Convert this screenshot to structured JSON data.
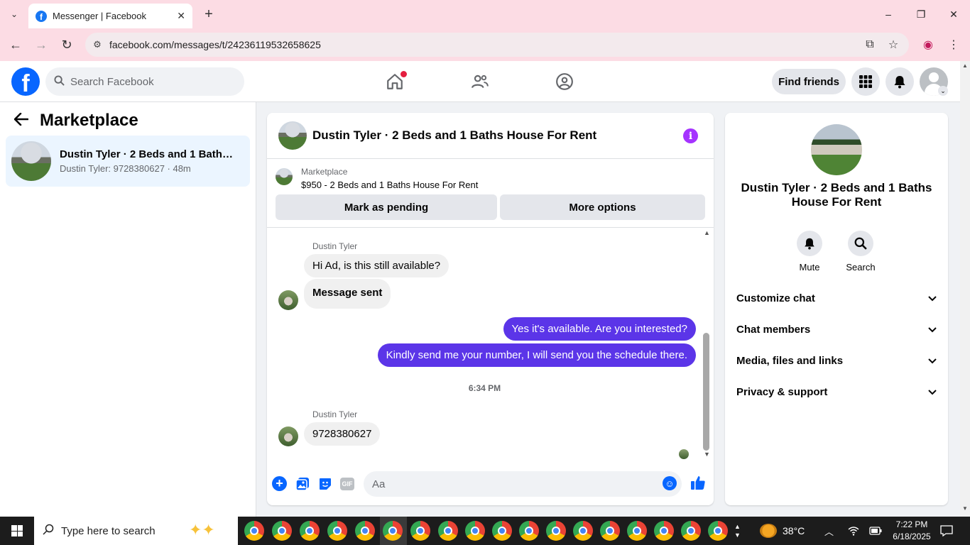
{
  "browser": {
    "tab_title": "Messenger | Facebook",
    "url": "facebook.com/messages/t/24236119532658625",
    "window_controls": {
      "minimize": "–",
      "maximize": "❐",
      "close": "✕"
    }
  },
  "fb_header": {
    "search_placeholder": "Search Facebook",
    "find_friends": "Find friends",
    "logo_letter": "f"
  },
  "left": {
    "title": "Marketplace",
    "conversation": {
      "name": "Dustin Tyler · 2 Beds and 1 Baths House For Rent",
      "preview": "Dustin Tyler: 9728380627 · 48m"
    }
  },
  "chat": {
    "title": "Dustin Tyler · 2 Beds and 1 Baths House For Rent",
    "listing_label": "Marketplace",
    "listing_price": "$950 - 2 Beds and 1 Baths House For Rent",
    "mark_pending": "Mark as pending",
    "more_options": "More options",
    "messages": [
      {
        "sender": "Dustin Tyler",
        "text": "Hi Ad, is this still available?"
      },
      {
        "text": "Message sent"
      },
      {
        "text": "Yes it's available. Are you interested?"
      },
      {
        "text": "Kindly send me your number, I will send you the schedule there."
      },
      {
        "timestamp": "6:34 PM"
      },
      {
        "sender": "Dustin Tyler",
        "text": "9728380627"
      }
    ],
    "composer_placeholder": "Aa",
    "gif_label": "GIF"
  },
  "right": {
    "name": "Dustin Tyler · 2 Beds and 1 Baths House For Rent",
    "mute": "Mute",
    "search": "Search",
    "sections": [
      "Customize chat",
      "Chat members",
      "Media, files and links",
      "Privacy & support"
    ]
  },
  "taskbar": {
    "search_text": "Type here to search",
    "weather": "38°C",
    "time": "7:22 PM",
    "date": "6/18/2025"
  },
  "colors": {
    "accent": "#0866ff",
    "outgoing_bubble": "#5b35e8",
    "info_icon": "#a533ff",
    "chrome_bg": "#fcdce4"
  }
}
